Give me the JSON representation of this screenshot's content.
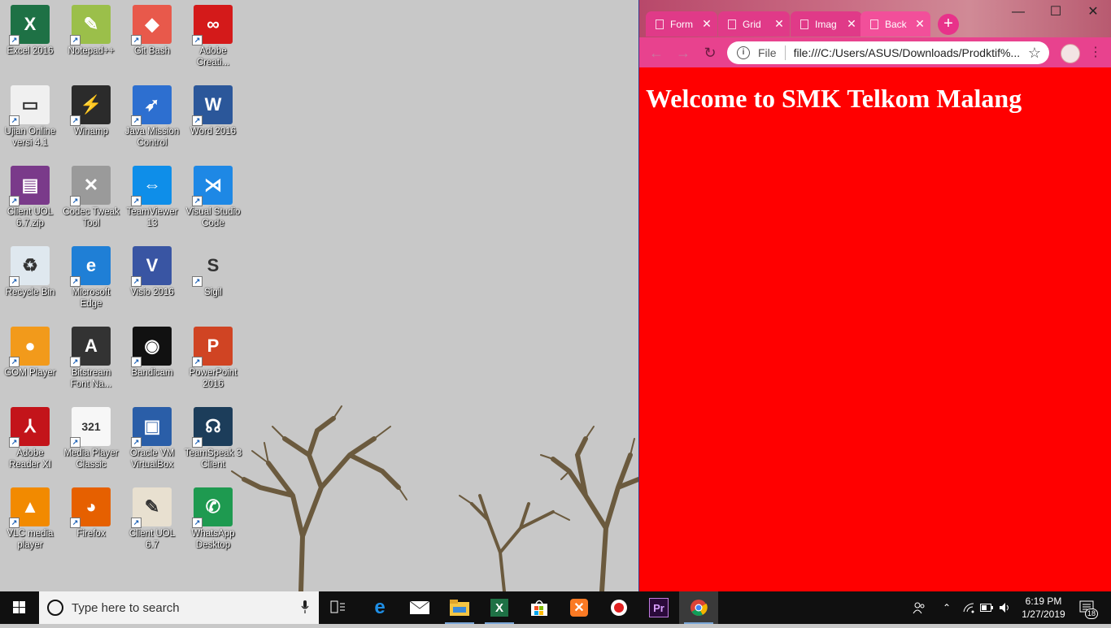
{
  "desktop": {
    "icons": [
      {
        "label": "Excel 2016",
        "icon": "excel-icon",
        "color": "#1e7145",
        "glyph": "X"
      },
      {
        "label": "Notepad++",
        "icon": "notepadpp-icon",
        "color": "#9bbf4a",
        "glyph": "✎"
      },
      {
        "label": "Git Bash",
        "icon": "git-bash-icon",
        "color": "#e8594b",
        "glyph": "◆"
      },
      {
        "label": "Adobe Creati...",
        "icon": "adobe-cc-icon",
        "color": "#d41a1a",
        "glyph": "∞"
      },
      {
        "label": "Ujian Online versi 4.1",
        "icon": "ujian-online-icon",
        "color": "#f0f0f0",
        "glyph": "▭"
      },
      {
        "label": "Winamp",
        "icon": "winamp-icon",
        "color": "#2b2b2b",
        "glyph": "⚡"
      },
      {
        "label": "Java Mission Control",
        "icon": "java-mission-control-icon",
        "color": "#2d6fd0",
        "glyph": "➶"
      },
      {
        "label": "Word 2016",
        "icon": "word-icon",
        "color": "#2b579a",
        "glyph": "W"
      },
      {
        "label": "Client UOL 6.7.zip",
        "icon": "winrar-icon",
        "color": "#7a3a8a",
        "glyph": "▤"
      },
      {
        "label": "Codec Tweak Tool",
        "icon": "tools-icon",
        "color": "#9a9a9a",
        "glyph": "✕"
      },
      {
        "label": "TeamViewer 13",
        "icon": "teamviewer-icon",
        "color": "#0e8ee9",
        "glyph": "⇔"
      },
      {
        "label": "Visual Studio Code",
        "icon": "vscode-icon",
        "color": "#1e88e5",
        "glyph": "⋊"
      },
      {
        "label": "Recycle Bin",
        "icon": "recycle-bin-icon",
        "color": "#dfe8ef",
        "glyph": "♻"
      },
      {
        "label": "Microsoft Edge",
        "icon": "edge-icon",
        "color": "#1f7fd6",
        "glyph": "e"
      },
      {
        "label": "Visio 2016",
        "icon": "visio-icon",
        "color": "#3955a3",
        "glyph": "V"
      },
      {
        "label": "Sigil",
        "icon": "sigil-icon",
        "color": "#c8c8c8",
        "glyph": "S"
      },
      {
        "label": "GOM Player",
        "icon": "gom-player-icon",
        "color": "#f29a1b",
        "glyph": "●"
      },
      {
        "label": "Bitstream Font Na...",
        "icon": "bitstream-icon",
        "color": "#333333",
        "glyph": "A"
      },
      {
        "label": "Bandicam",
        "icon": "bandicam-icon",
        "color": "#111111",
        "glyph": "◉"
      },
      {
        "label": "PowerPoint 2016",
        "icon": "powerpoint-icon",
        "color": "#d04423",
        "glyph": "P"
      },
      {
        "label": "Adobe Reader XI",
        "icon": "adobe-reader-icon",
        "color": "#c3141a",
        "glyph": "⅄"
      },
      {
        "label": "Media Player Classic",
        "icon": "mpc-icon",
        "color": "#f7f7f7",
        "glyph": "321"
      },
      {
        "label": "Oracle VM VirtualBox",
        "icon": "virtualbox-icon",
        "color": "#2a5ea8",
        "glyph": "▣"
      },
      {
        "label": "TeamSpeak 3 Client",
        "icon": "teamspeak-icon",
        "color": "#1c3d5a",
        "glyph": "☊"
      },
      {
        "label": "VLC media player",
        "icon": "vlc-icon",
        "color": "#f28a00",
        "glyph": "▲"
      },
      {
        "label": "Firefox",
        "icon": "firefox-icon",
        "color": "#e66000",
        "glyph": "◕"
      },
      {
        "label": "Client UOL 6.7",
        "icon": "client-uol-icon",
        "color": "#e8e0d0",
        "glyph": "✎"
      },
      {
        "label": "WhatsApp Desktop",
        "icon": "whatsapp-icon",
        "color": "#1e9a50",
        "glyph": "✆"
      }
    ]
  },
  "browser": {
    "tabs": [
      {
        "title": "Form"
      },
      {
        "title": "Grid"
      },
      {
        "title": "Imag"
      },
      {
        "title": "Back"
      }
    ],
    "active_tab": 3,
    "new_tab_label": "+",
    "omnibox": {
      "scheme": "File",
      "url": "file:///C:/Users/ASUS/Downloads/Prodktif%..."
    },
    "page": {
      "heading": "Welcome to SMK Telkom Malang",
      "background": "#ff0000"
    }
  },
  "taskbar": {
    "search_placeholder": "Type here to search",
    "pinned": [
      "task-view-icon",
      "edge-icon",
      "mail-icon",
      "file-explorer-icon",
      "excel-icon",
      "store-icon",
      "xampp-icon",
      "bandicam-icon",
      "premiere-icon",
      "chrome-icon"
    ],
    "clock": {
      "time": "6:19 PM",
      "date": "1/27/2019"
    },
    "notifications_count": "18"
  }
}
